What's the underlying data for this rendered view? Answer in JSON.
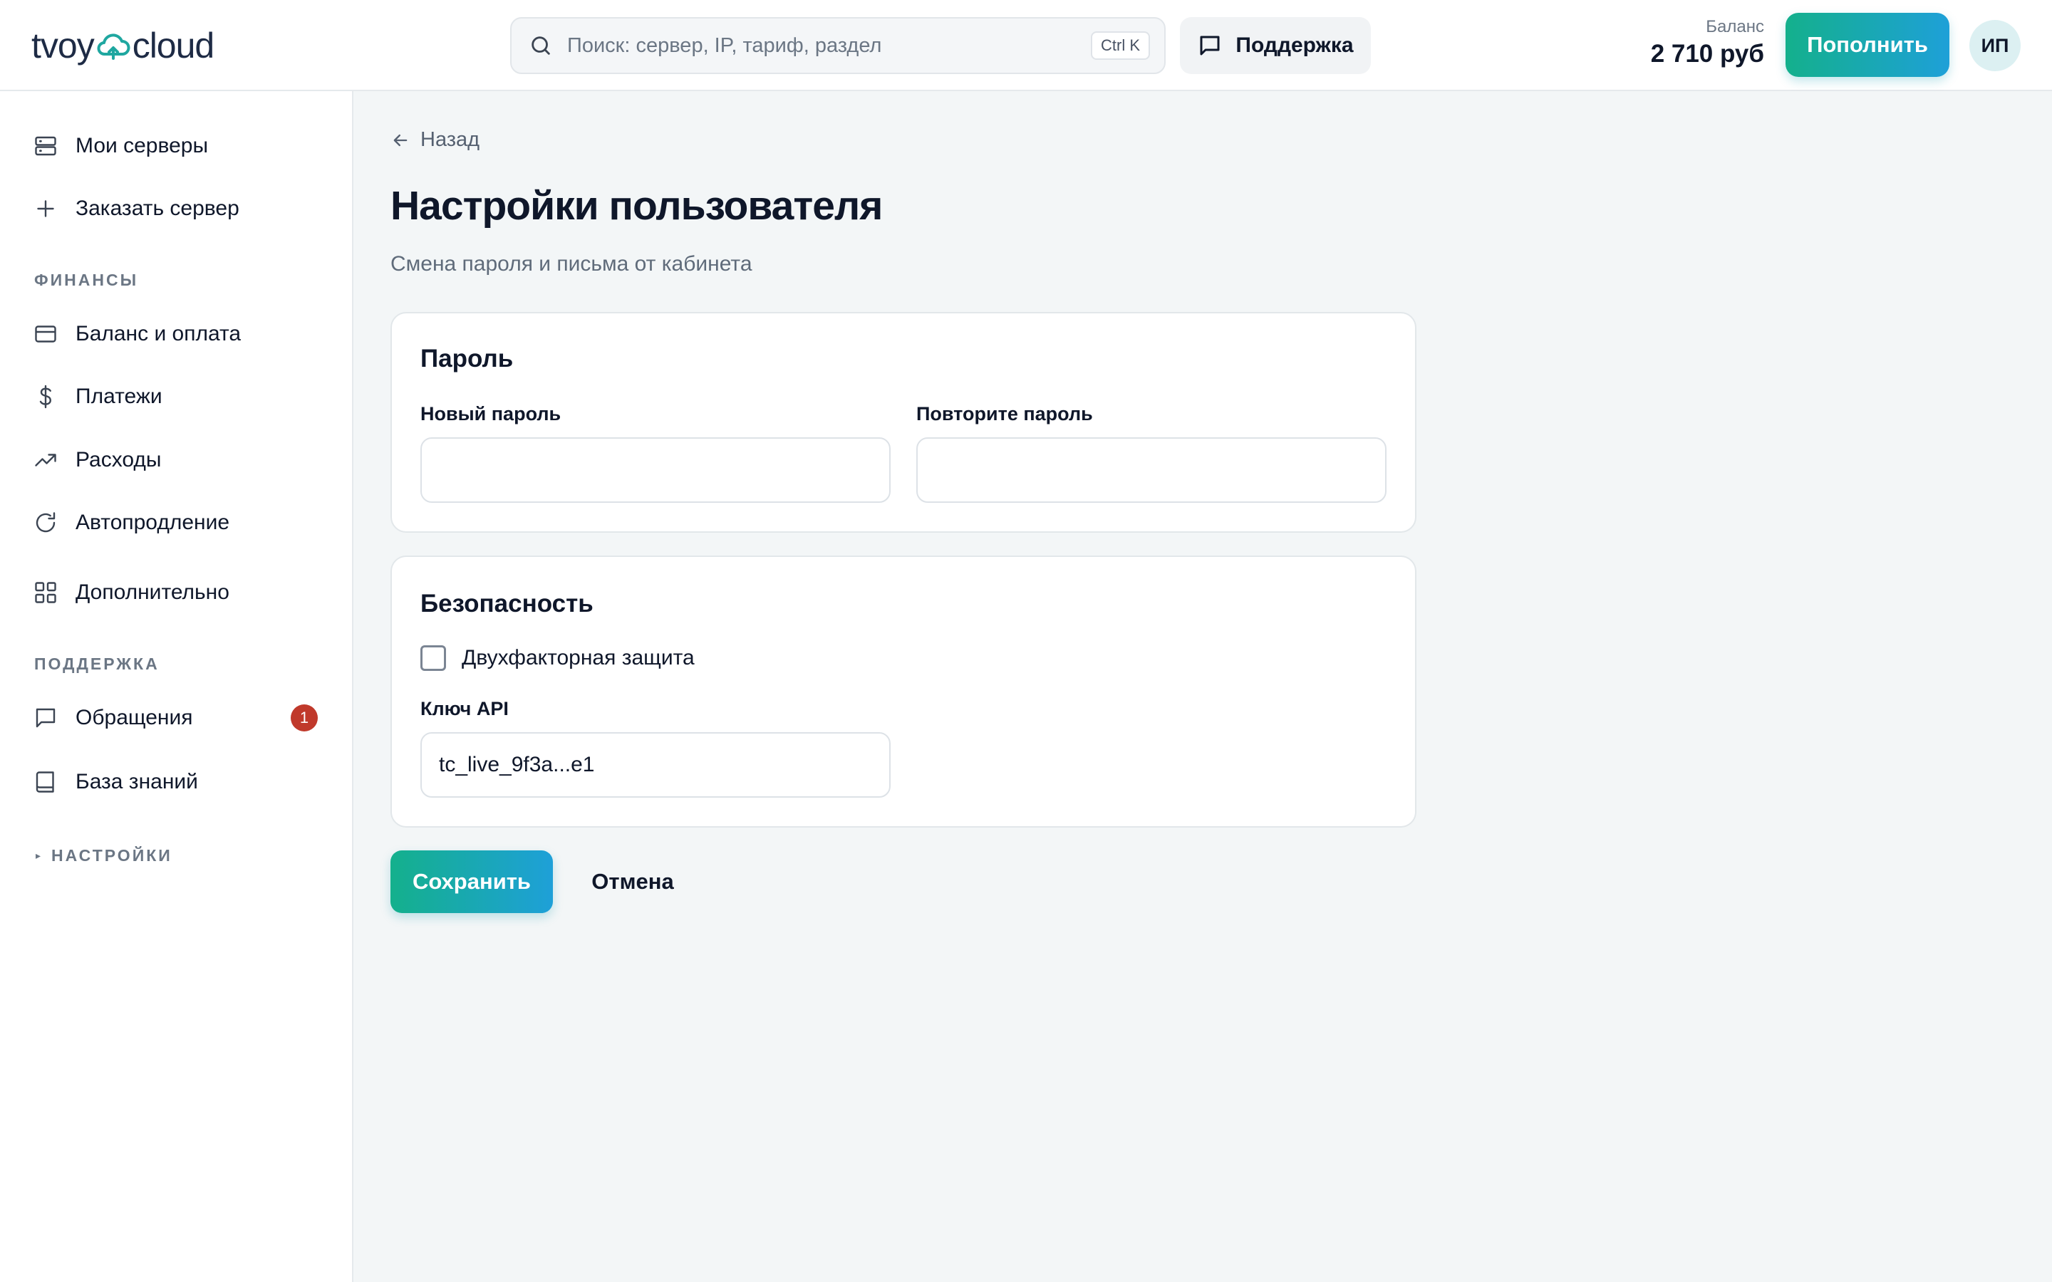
{
  "header": {
    "logo_left": "tvoy",
    "logo_right": "cloud",
    "search_placeholder": "Поиск: сервер, IP, тариф, раздел",
    "search_shortcut": "Ctrl K",
    "support_label": "Поддержка",
    "balance_label": "Баланс",
    "balance_value": "2 710 руб",
    "topup_label": "Пополнить",
    "avatar_initials": "ИП"
  },
  "sidebar": {
    "items_top": [
      {
        "label": "Мои серверы",
        "icon": "server-icon"
      },
      {
        "label": "Заказать сервер",
        "icon": "plus-icon"
      }
    ],
    "section_finance": "ФИНАНСЫ",
    "items_finance": [
      {
        "label": "Баланс и оплата",
        "icon": "credit-card-icon"
      },
      {
        "label": "Платежи",
        "icon": "dollar-icon"
      },
      {
        "label": "Расходы",
        "icon": "trending-up-icon"
      },
      {
        "label": "Автопродление",
        "icon": "refresh-icon"
      },
      {
        "label": "Дополнительно",
        "icon": "grid-icon"
      }
    ],
    "section_support": "ПОДДЕРЖКА",
    "items_support": [
      {
        "label": "Обращения",
        "icon": "message-icon",
        "badge": "1"
      },
      {
        "label": "База знаний",
        "icon": "book-icon"
      }
    ],
    "section_settings": "НАСТРОЙКИ"
  },
  "main": {
    "back_label": "Назад",
    "title": "Настройки пользователя",
    "subtitle": "Смена пароля и письма от кабинета",
    "password_card": {
      "title": "Пароль",
      "new_password_label": "Новый пароль",
      "new_password_value": "",
      "repeat_password_label": "Повторите пароль",
      "repeat_password_value": ""
    },
    "security_card": {
      "title": "Безопасность",
      "two_factor_label": "Двухфакторная защита",
      "two_factor_checked": false,
      "api_key_label": "Ключ API",
      "api_key_value": "tc_live_9f3a...e1"
    },
    "save_label": "Сохранить",
    "cancel_label": "Отмена"
  },
  "colors": {
    "accent_start": "#14b08c",
    "accent_end": "#1ea0d8",
    "badge": "#c0392b",
    "text_primary": "#0f172a",
    "text_muted": "#5f6b7a"
  }
}
